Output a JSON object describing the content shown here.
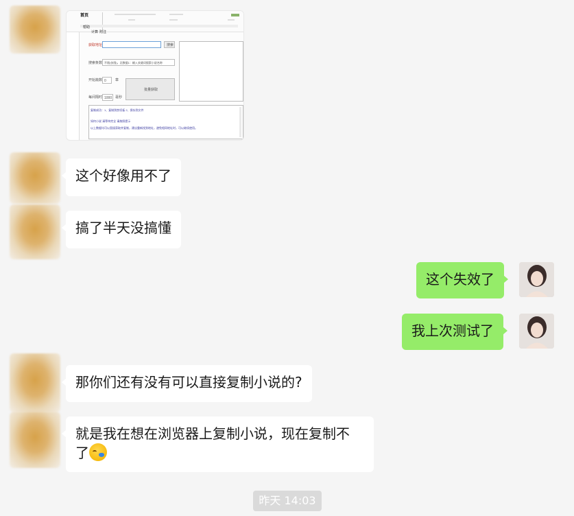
{
  "messages": [
    {
      "id": "m1",
      "side": "in",
      "type": "image"
    },
    {
      "id": "m2",
      "side": "in",
      "text": "这个好像用不了"
    },
    {
      "id": "m3",
      "side": "in",
      "text": "搞了半天没搞懂"
    },
    {
      "id": "m4",
      "side": "out",
      "text": "这个失效了"
    },
    {
      "id": "m5",
      "side": "out",
      "text": "我上次测试了"
    },
    {
      "id": "m6",
      "side": "in",
      "text": "那你们还有没有可以直接复制小说的?"
    },
    {
      "id": "m7",
      "side": "in",
      "text_line1": "就是我在想在浏览器上复制小说，现在复制不",
      "text_line2": "了",
      "emoji": "crying-laughing-emoji"
    }
  ],
  "screenshot": {
    "tab_title": "首页",
    "menu": [
      "帮助",
      "计算",
      "附注"
    ],
    "label_url": "获取地址:",
    "btn_search": "搜索",
    "label_fields": "搜索条数:",
    "fields_value": "不限(仅限)，无数据1：输入关键词搜索小说名称",
    "label_count": "开始篇数:",
    "count_value": "0",
    "count_unit": "章",
    "label_delay": "每间隔时:",
    "delay_value": "1000",
    "delay_unit": "毫秒",
    "btn_start": "批量获取",
    "log_lines": [
      "复制成功：1、复制到剪切板    2、保存到文件",
      "如何小说 请等待完全 请按照提示",
      "以上数据均可以直接获取并复制，建议重新找到地址，避免相同地址时，可以继续使用。"
    ]
  },
  "timestamp": "昨天 14:03",
  "colors": {
    "outgoing": "#95ec69",
    "incoming": "#ffffff",
    "background": "#f5f5f5"
  }
}
